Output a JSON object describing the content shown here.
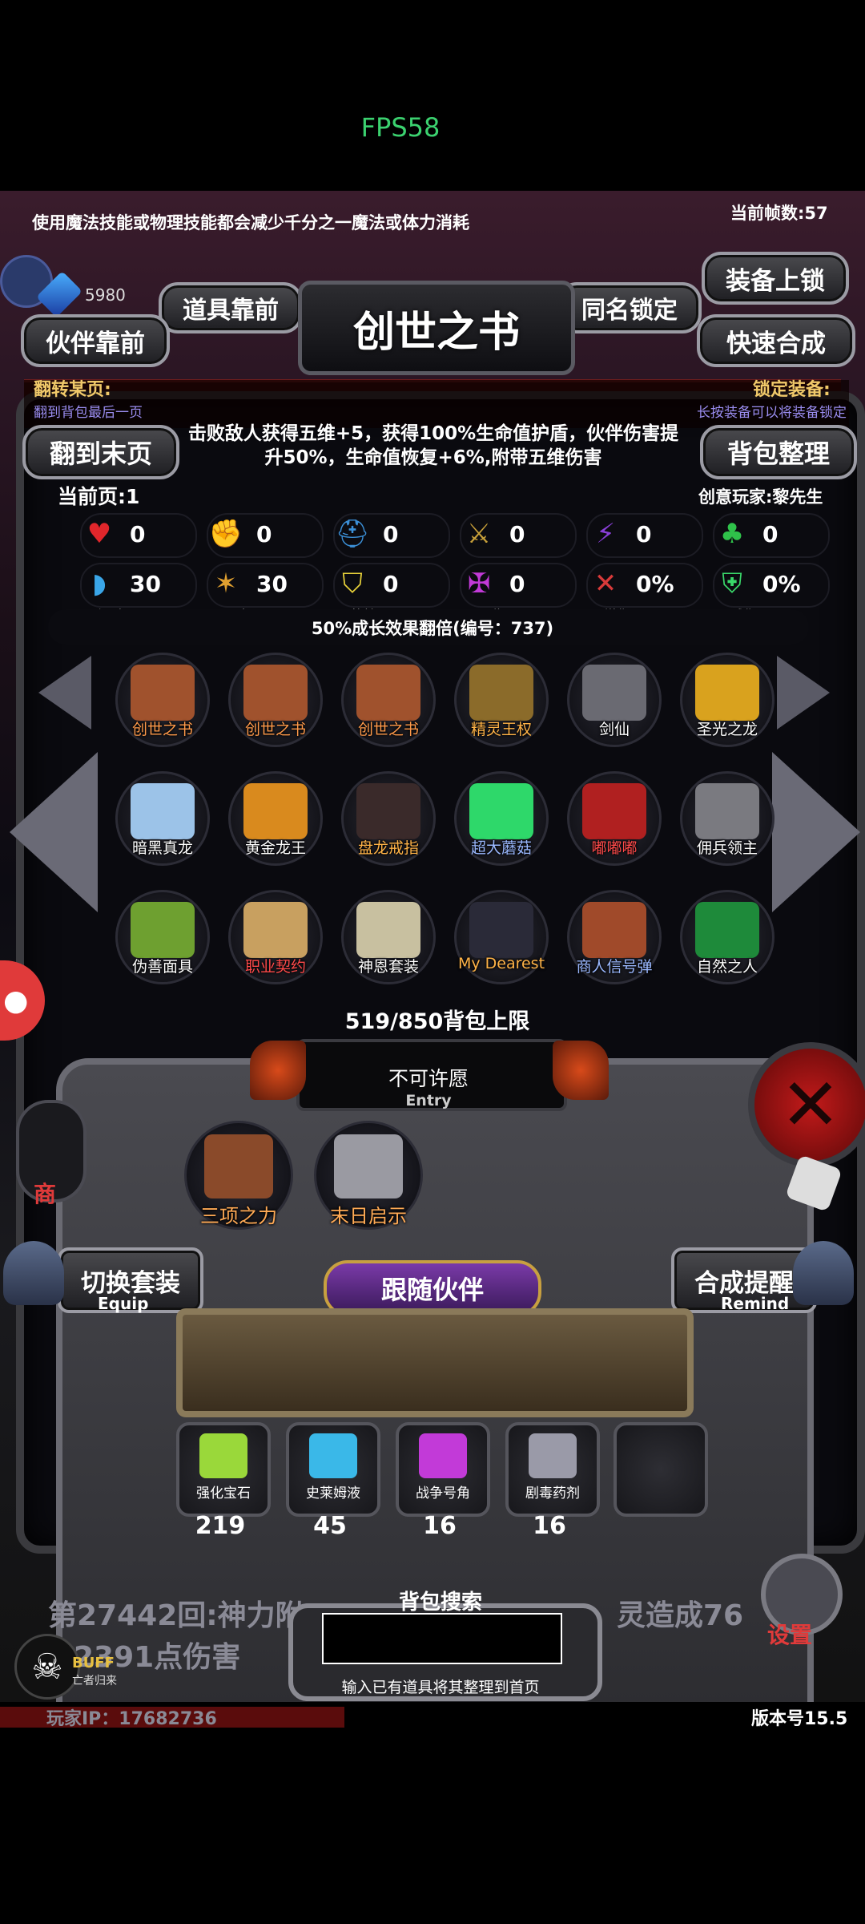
{
  "status_bar": {
    "fps": "FPS58"
  },
  "top": {
    "tip": "使用魔法技能或物理技能都会减少千分之一魔法或体力消耗",
    "frame_count": "当前帧数:57",
    "currency": "5980"
  },
  "buttons": {
    "items_front": "道具靠前",
    "same_name_lock": "同名锁定",
    "equip_lock": "装备上锁",
    "partner_front": "伙伴靠前",
    "quick_combine": "快速合成",
    "title": "创世之书",
    "to_last_page": "翻到末页",
    "bag_sort": "背包整理"
  },
  "hints": {
    "flip_page": "翻转某页:",
    "flip_page_sub": "翻到背包最后一页",
    "lock_equip": "锁定装备:",
    "lock_equip_sub": "长按装备可以将装备锁定"
  },
  "description": "击败敌人获得五维+5，获得100%生命值护盾，伙伴伤害提升50%，生命值恢复+6%,附带五维伤害",
  "page_info": {
    "current_page": "当前页:1",
    "creator": "创意玩家:黎先生"
  },
  "stats_row1": [
    {
      "icon": "heart-icon",
      "value": "0",
      "color": "#e0262b"
    },
    {
      "icon": "strength-icon",
      "value": "0",
      "color": "#d8c33a"
    },
    {
      "icon": "helmet-icon",
      "value": "0",
      "color": "#3b8fd6"
    },
    {
      "icon": "sword-icon",
      "value": "0",
      "color": "#c9a13a"
    },
    {
      "icon": "lightning-icon",
      "value": "0",
      "color": "#8a3fd8"
    },
    {
      "icon": "clover-icon",
      "value": "0",
      "color": "#2fc24a"
    }
  ],
  "stats_row2": [
    {
      "icon": "dodge-icon",
      "value": "30",
      "label": "闪避",
      "color": "#3aa6e8"
    },
    {
      "icon": "crit-icon",
      "value": "30",
      "label": "暴击",
      "color": "#e0a030"
    },
    {
      "icon": "block-icon",
      "value": "0",
      "label": "格挡",
      "color": "#e8d23a"
    },
    {
      "icon": "invincible-icon",
      "value": "0",
      "label": "无敌",
      "color": "#c23ad8"
    },
    {
      "icon": "damage-up-icon",
      "value": "0%",
      "label": "增伤",
      "color": "#d83a3a"
    },
    {
      "icon": "damage-down-icon",
      "value": "0%",
      "label": "减伤",
      "color": "#3ad86a"
    }
  ],
  "growth_note": "50%成长效果翻倍(编号：737)",
  "items": [
    {
      "name": "创世之书",
      "color": "#ff9a4a",
      "art": "#a0522d"
    },
    {
      "name": "创世之书",
      "color": "#ff9a4a",
      "art": "#a0522d"
    },
    {
      "name": "创世之书",
      "color": "#ff9a4a",
      "art": "#a0522d"
    },
    {
      "name": "精灵王权",
      "color": "#ffb347",
      "art": "#8b6b2a"
    },
    {
      "name": "剑仙",
      "color": "#ffffff",
      "art": "#6a6a72"
    },
    {
      "name": "圣光之龙",
      "color": "#ffffff",
      "art": "#d9a21e"
    },
    {
      "name": "暗黑真龙",
      "color": "#ffffff",
      "art": "#9cc3e8"
    },
    {
      "name": "黄金龙王",
      "color": "#ffffff",
      "art": "#d98a1e"
    },
    {
      "name": "盘龙戒指",
      "color": "#ffb347",
      "art": "#3a2a2a"
    },
    {
      "name": "超大蘑菇",
      "color": "#9ab8ff",
      "art": "#2ed86a"
    },
    {
      "name": "嘟嘟嘟",
      "color": "#ff4a4a",
      "art": "#b02020"
    },
    {
      "name": "佣兵领主",
      "color": "#ffffff",
      "art": "#7a7a80"
    },
    {
      "name": "伪善面具",
      "color": "#ffffff",
      "art": "#6ea030"
    },
    {
      "name": "职业契约",
      "color": "#ff4a4a",
      "art": "#c8a060"
    },
    {
      "name": "神恩套装",
      "color": "#ffffff",
      "art": "#c8c0a0"
    },
    {
      "name": "My Dearest",
      "color": "#ffb347",
      "art": "#2a2a38"
    },
    {
      "name": "商人信号弹",
      "color": "#9ab8ff",
      "art": "#a04a2a"
    },
    {
      "name": "自然之人",
      "color": "#ffffff",
      "art": "#1e8a3a"
    }
  ],
  "bag_capacity": "519/850背包上限",
  "wish": {
    "title": "不可许愿",
    "sub": "Entry"
  },
  "set_items": [
    {
      "name": "三项之力",
      "art": "#8a4a2a"
    },
    {
      "name": "末日启示",
      "art": "#9a9aa2"
    }
  ],
  "lower_buttons": {
    "switch_set": "切换套装",
    "switch_set_sub": "Equip",
    "follow_partner": "跟随伙伴",
    "combine_remind": "合成提醒",
    "combine_remind_sub": "Remind",
    "shop": "商",
    "settings": "设置"
  },
  "bag_items": [
    {
      "name": "强化宝石",
      "count": "219",
      "art": "#9ad83a"
    },
    {
      "name": "史莱姆液",
      "count": "45",
      "art": "#3ab8e8"
    },
    {
      "name": "战争号角",
      "count": "16",
      "art": "#c23ad8"
    },
    {
      "name": "剧毒药剂",
      "count": "16",
      "art": "#9a9aa8"
    }
  ],
  "battle_log": {
    "line1": "第27442回:神力附",
    "line1_tail": "灵造成76",
    "line2": "2391点伤害"
  },
  "search": {
    "title": "背包搜索",
    "placeholder": "",
    "hint": "输入已有道具将其整理到首页"
  },
  "buff": {
    "label": "BUFF",
    "sub": "亡者归来"
  },
  "footer": {
    "ip": "玩家IP：17682736",
    "version": "版本号15.5"
  }
}
